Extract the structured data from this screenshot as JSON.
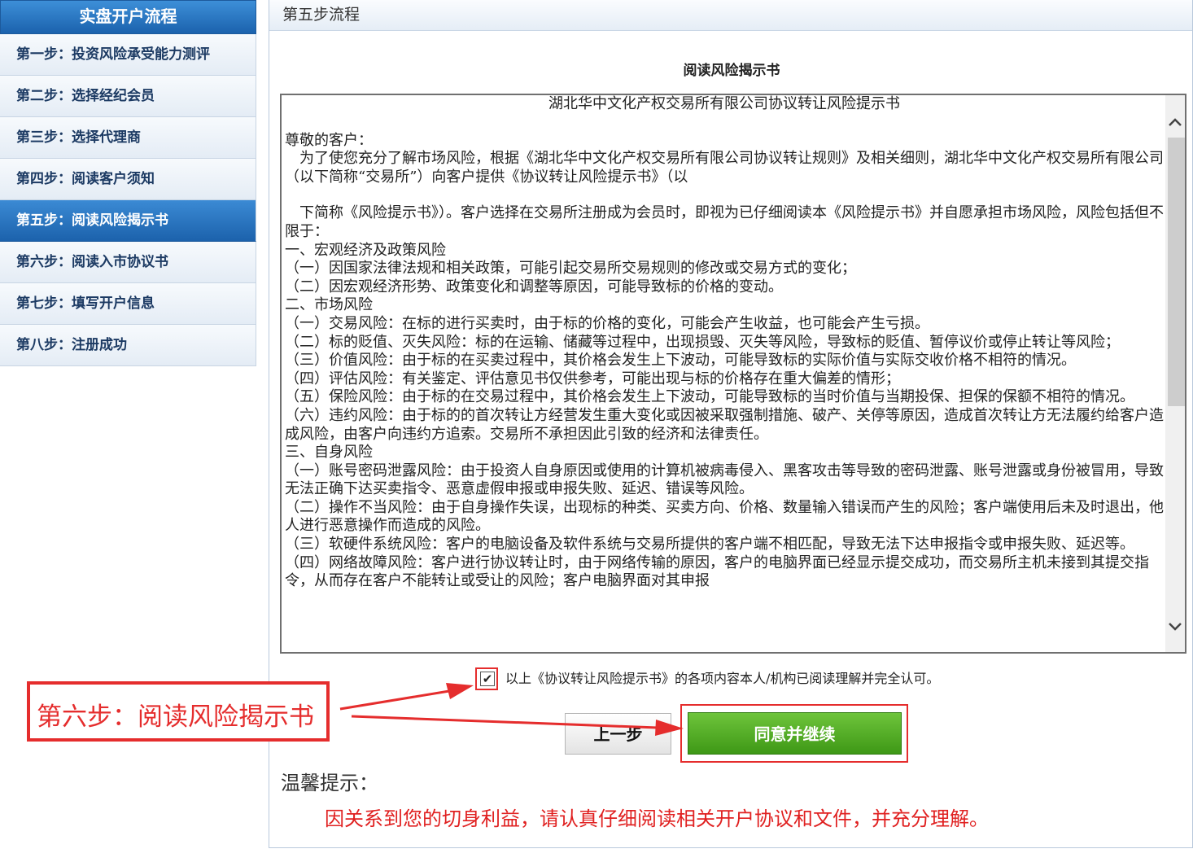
{
  "sidebar": {
    "title": "实盘开户流程",
    "items": [
      {
        "label": "第一步：投资风险承受能力测评"
      },
      {
        "label": "第二步：选择经纪会员"
      },
      {
        "label": "第三步：选择代理商"
      },
      {
        "label": "第四步：阅读客户须知"
      },
      {
        "label": "第五步：阅读风险揭示书"
      },
      {
        "label": "第六步：阅读入市协议书"
      },
      {
        "label": "第七步：填写开户信息"
      },
      {
        "label": "第八步：注册成功"
      }
    ],
    "active_index": 4
  },
  "main": {
    "header": "第五步流程",
    "doc_title": "阅读风险揭示书",
    "document": {
      "heading": "湖北华中文化产权交易所有限公司协议转让风险提示书",
      "paragraphs": [
        "尊敬的客户：",
        "　为了使您充分了解市场风险，根据《湖北华中文化产权交易所有限公司协议转让规则》及相关细则，湖北华中文化产权交易所有限公司（以下简称“交易所”）向客户提供《协议转让风险提示书》（以",
        "",
        "　下简称《风险提示书》）。客户选择在交易所注册成为会员时，即视为已仔细阅读本《风险提示书》并自愿承担市场风险，风险包括但不限于：",
        "一、宏观经济及政策风险",
        "（一）因国家法律法规和相关政策，可能引起交易所交易规则的修改或交易方式的变化；",
        "（二）因宏观经济形势、政策变化和调整等原因，可能导致标的价格的变动。",
        "二、市场风险",
        "（一）交易风险：在标的进行买卖时，由于标的价格的变化，可能会产生收益，也可能会产生亏损。",
        "（二）标的贬值、灭失风险：标的在运输、储藏等过程中，出现损毁、灭失等风险，导致标的贬值、暂停议价或停止转让等风险；",
        "（三）价值风险：由于标的在买卖过程中，其价格会发生上下波动，可能导致标的实际价值与实际交收价格不相符的情况。",
        "（四）评估风险：有关鉴定、评估意见书仅供参考，可能出现与标的价格存在重大偏差的情形；",
        "（五）保险风险：由于标的在交易过程中，其价格会发生上下波动，可能导致标的当时价值与当期投保、担保的保额不相符的情况。",
        "（六）违约风险：由于标的的首次转让方经营发生重大变化或因被采取强制措施、破产、关停等原因，造成首次转让方无法履约给客户造成风险，由客户向违约方追索。交易所不承担因此引致的经济和法律责任。",
        "三、自身风险",
        "（一）账号密码泄露风险：由于投资人自身原因或使用的计算机被病毒侵入、黑客攻击等导致的密码泄露、账号泄露或身份被冒用，导致无法正确下达买卖指令、恶意虚假申报或申报失败、延迟、错误等风险。",
        "（二）操作不当风险：由于自身操作失误，出现标的种类、买卖方向、价格、数量输入错误而产生的风险；客户端使用后未及时退出，他人进行恶意操作而造成的风险。",
        "（三）软硬件系统风险：客户的电脑设备及软件系统与交易所提供的客户端不相匹配，导致无法下达申报指令或申报失败、延迟等。",
        "（四）网络故障风险：客户进行协议转让时，由于网络传输的原因，客户的电脑界面已经显示提交成功，而交易所主机未接到其提交指令，从而存在客户不能转让或受让的风险；客户电脑界面对其申报"
      ]
    },
    "agree_text": "以上《协议转让风险提示书》的各项内容本人/机构已阅读理解并完全认可。",
    "agree_checked": true,
    "prev_button": "上一步",
    "next_button": "同意并继续",
    "tip_title": "温馨提示：",
    "tip_text": "因关系到您的切身利益，请认真仔细阅读相关开户协议和文件，并充分理解。"
  },
  "annotation": {
    "label": "第六步：阅读风险揭示书"
  },
  "colors": {
    "accent_blue": "#1c62ac",
    "button_green": "#3e9816",
    "annotation_red": "#e52d2d",
    "tip_red": "#e02020"
  },
  "icons": {
    "check": "check-icon",
    "scroll_up": "chevron-up-icon",
    "scroll_down": "chevron-down-icon"
  }
}
